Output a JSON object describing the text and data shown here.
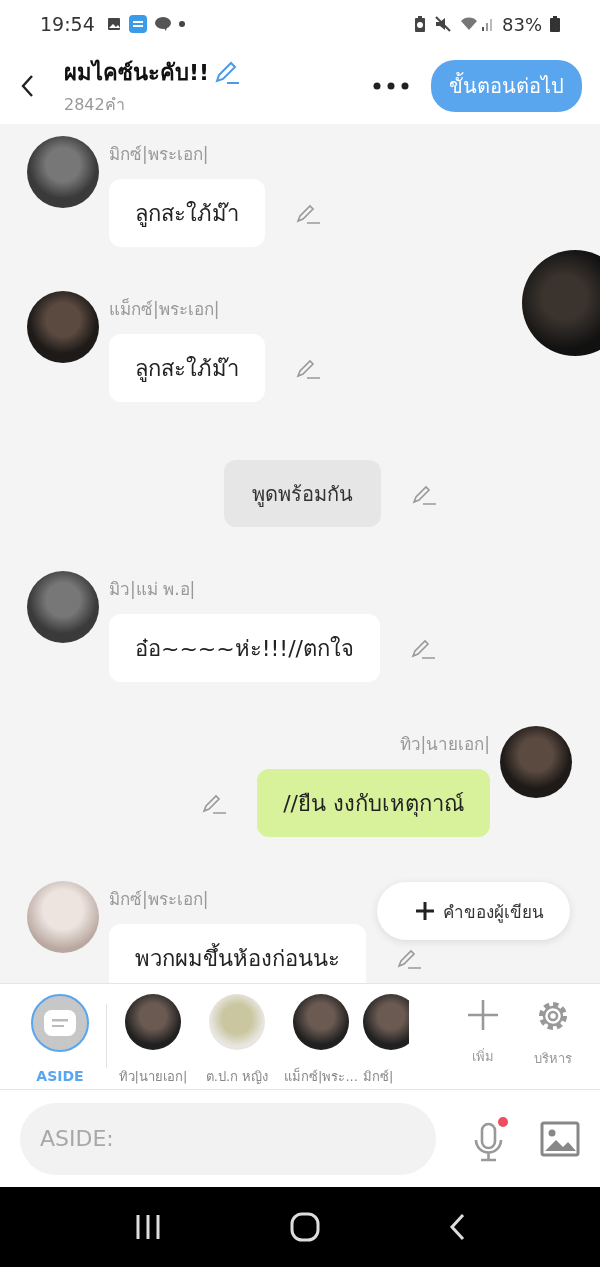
{
  "status_bar": {
    "time": "19:54",
    "battery": "83%"
  },
  "header": {
    "title": "ผมไคซ์นะคับ!!",
    "word_count": "2842คำ",
    "next_button": "ขั้นตอนต่อไป"
  },
  "messages": [
    {
      "kind": "left",
      "name": "มิกซ์|พระเอก|",
      "text": "ลูกสะใภ้ม๊า"
    },
    {
      "kind": "left",
      "name": "แม็กซ์|พระเอก|",
      "text": "ลูกสะใภ้ม๊า"
    },
    {
      "kind": "narration",
      "text": "พูดพร้อมกัน"
    },
    {
      "kind": "left",
      "name": "มิว|แม่ พ.อ|",
      "text": "อ๋อ~~~~ห่ะ!!!//ตกใจ"
    },
    {
      "kind": "right",
      "name": "ทิว|นายเอก|",
      "text": "//ยืน งงกับเหตุกาณ์"
    },
    {
      "kind": "left",
      "name": "มิกซ์|พระเอก|",
      "text": "พวกผมขึ้นห้องก่อนนะ"
    }
  ],
  "author_note_button": "คำของผู้เขียน",
  "characters": [
    {
      "label": "ASIDE",
      "kind": "aside",
      "selected": true
    },
    {
      "label": "ทิว|นายเอก|",
      "kind": "photo",
      "selected": false
    },
    {
      "label": "ต.ป.ก หญิง",
      "kind": "drawn",
      "selected": false
    },
    {
      "label": "แม็กซ์|พระ...",
      "kind": "photo",
      "selected": false
    },
    {
      "label": "มิกซ์|",
      "kind": "photo",
      "selected": false,
      "cut_off": true
    }
  ],
  "add_button": "เพิ่ม",
  "manage_button": "บริหาร",
  "input": {
    "placeholder": "ASIDE:"
  }
}
